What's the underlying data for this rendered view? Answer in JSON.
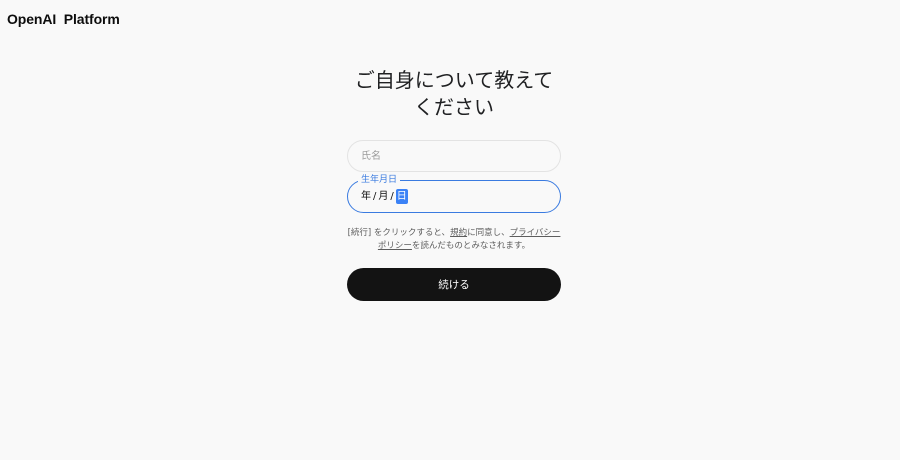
{
  "brand": {
    "name": "OpenAI  Platform"
  },
  "form": {
    "title_line1": "ご自身について教えて",
    "title_line2": "ください",
    "name_placeholder": "氏名",
    "name_value": "",
    "dob": {
      "label": "生年月日",
      "year": "年",
      "month": "月",
      "day": "日",
      "separator": "/"
    },
    "terms": {
      "part1": "[続行] をクリックすると、",
      "terms_link": "規約",
      "part2": "に同意し、",
      "privacy_link": "プライバシーポリシー",
      "part3": "を読んだものとみなされます。"
    },
    "continue_label": "続ける"
  }
}
